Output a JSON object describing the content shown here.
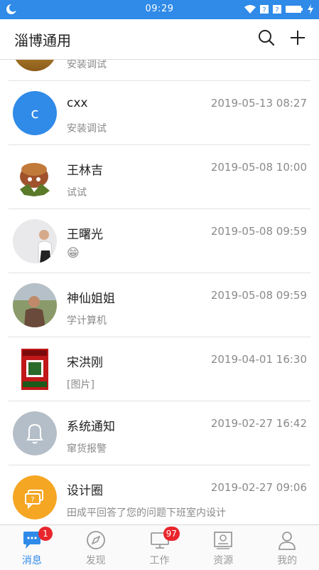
{
  "status_bar": {
    "time": "09:29"
  },
  "header": {
    "title": "淄博通用"
  },
  "conversations": [
    {
      "name": "",
      "date": "",
      "message": "安装调试"
    },
    {
      "name": "cxx",
      "avatar_letter": "c",
      "date": "2019-05-13 08:27",
      "message": "安装调试"
    },
    {
      "name": "王林吉",
      "date": "2019-05-08 10:00",
      "message": "试试"
    },
    {
      "name": "王曙光",
      "date": "2019-05-08 09:59",
      "message": "😁"
    },
    {
      "name": "神仙姐姐",
      "date": "2019-05-08 09:59",
      "message": "学计算机"
    },
    {
      "name": "宋洪刚",
      "date": "2019-04-01 16:30",
      "message": "[图片]"
    },
    {
      "name": "系统通知",
      "date": "2019-02-27 16:42",
      "message": "窜货报警"
    },
    {
      "name": "设计圈",
      "date": "2019-02-27 09:06",
      "message": "田成平回答了您的问题下班室内设计"
    }
  ],
  "tabs": [
    {
      "label": "消息",
      "icon": "chat-bubble-icon",
      "badge": "1",
      "active": true
    },
    {
      "label": "发现",
      "icon": "compass-icon"
    },
    {
      "label": "工作",
      "icon": "monitor-icon",
      "badge": "97"
    },
    {
      "label": "资源",
      "icon": "certificate-icon"
    },
    {
      "label": "我的",
      "icon": "person-icon"
    }
  ],
  "colors": {
    "brand": "#2f8ae8",
    "badge": "#e8262c",
    "notice_avatar": "#b4bec8",
    "circle_avatar": "#f5a623"
  }
}
